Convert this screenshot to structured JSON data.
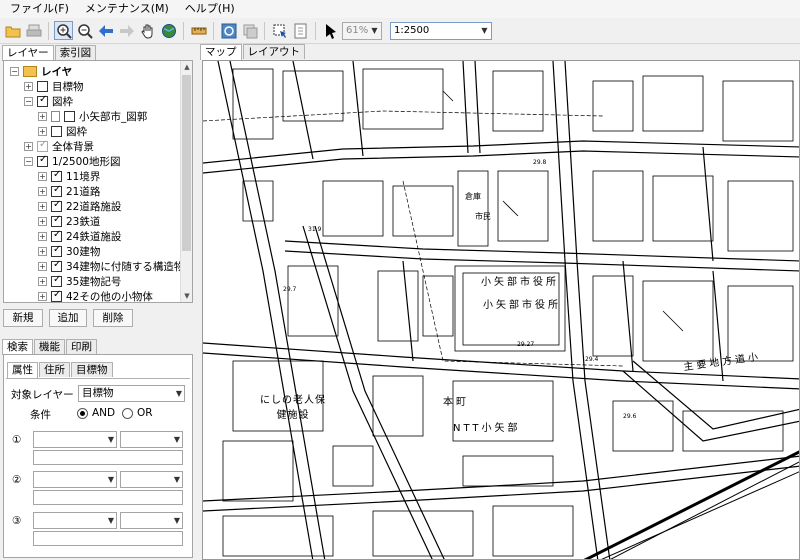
{
  "menu": [
    "ファイル(F)",
    "メンテナンス(M)",
    "ヘルプ(H)"
  ],
  "toolbar": {
    "zoom_value": "61%",
    "scale_value": "1:2500",
    "icons": [
      "open-folder-icon",
      "print-icon",
      "zoom-in-icon",
      "zoom-out-icon",
      "back-arrow-icon",
      "forward-arrow-icon",
      "pan-hand-icon",
      "globe-icon",
      "ruler-icon",
      "refresh-map-icon",
      "layers-icon",
      "select-area-icon",
      "export-icon",
      "pointer-icon"
    ]
  },
  "layer_tabs": [
    "レイヤー",
    "索引図"
  ],
  "layers": [
    {
      "label": "レイヤ",
      "level": 0,
      "checkbox": false,
      "expanded": true,
      "folder": true
    },
    {
      "label": "目標物",
      "level": 1,
      "checkbox": true,
      "checked": false
    },
    {
      "label": "図枠",
      "level": 1,
      "checkbox": true,
      "checked": true,
      "expanded": true
    },
    {
      "label": "小矢部市_図郭",
      "level": 2,
      "checkbox": true,
      "checked": false,
      "doc": true
    },
    {
      "label": "図枠",
      "level": 2,
      "checkbox": true,
      "checked": false
    },
    {
      "label": "全体背景",
      "level": 1,
      "checkbox": true,
      "checked": true,
      "dim": true
    },
    {
      "label": "1/2500地形図",
      "level": 1,
      "checkbox": true,
      "checked": true,
      "expanded": true
    },
    {
      "label": "11境界",
      "level": 2,
      "checkbox": true,
      "checked": true
    },
    {
      "label": "21道路",
      "level": 2,
      "checkbox": true,
      "checked": true
    },
    {
      "label": "22道路施設",
      "level": 2,
      "checkbox": true,
      "checked": true
    },
    {
      "label": "23鉄道",
      "level": 2,
      "checkbox": true,
      "checked": true
    },
    {
      "label": "24鉄道施設",
      "level": 2,
      "checkbox": true,
      "checked": true
    },
    {
      "label": "30建物",
      "level": 2,
      "checkbox": true,
      "checked": true
    },
    {
      "label": "34建物に付随する構造物",
      "level": 2,
      "checkbox": true,
      "checked": true
    },
    {
      "label": "35建物記号",
      "level": 2,
      "checkbox": true,
      "checked": true
    },
    {
      "label": "42その他の小物体",
      "level": 2,
      "checkbox": true,
      "checked": true
    }
  ],
  "layer_buttons": {
    "new": "新規",
    "add": "追加",
    "delete": "削除"
  },
  "search_tabs": [
    "検索",
    "機能",
    "印刷"
  ],
  "search_subtabs": [
    "属性",
    "住所",
    "目標物"
  ],
  "search": {
    "target_label": "対象レイヤー",
    "target_value": "目標物",
    "condition_label": "条件",
    "and_label": "AND",
    "or_label": "OR",
    "condition_selected": "AND",
    "rows": [
      "①",
      "②",
      "③"
    ]
  },
  "map_tabs": [
    "マップ",
    "レイアウト"
  ],
  "map": {
    "labels": [
      {
        "text": "小矢部市役所"
      },
      {
        "text": "小矢部市役所"
      },
      {
        "text": "本町"
      },
      {
        "text": "NTT小矢部"
      },
      {
        "text": "主要地方道小"
      },
      {
        "text": "にしの老人保健施設"
      },
      {
        "text": "倉庫"
      },
      {
        "text": "市民"
      }
    ],
    "elevations": [
      "29.27",
      "29.8",
      "29.6",
      "29.7",
      "31.9",
      "29.4"
    ]
  },
  "colors": {
    "accent": "#7a9cc6",
    "panel_bg": "#f0f0f0"
  }
}
